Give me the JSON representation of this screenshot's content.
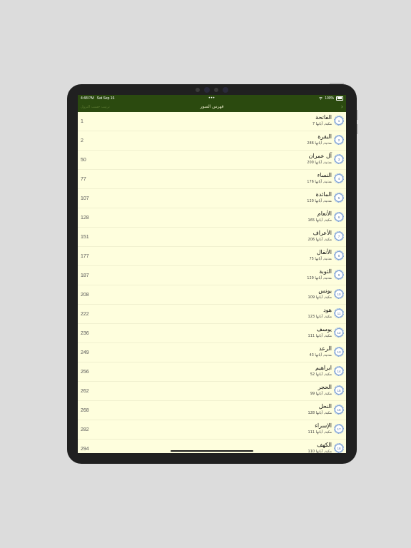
{
  "status": {
    "time": "4:48 PM",
    "date": "Sat Sep 16",
    "dots": "•••",
    "battery": "100%"
  },
  "nav": {
    "title": "فهرس السور",
    "left_label": "ترتيب حسب النزول",
    "back_icon": "chevron-right-icon"
  },
  "surahs": [
    {
      "number": "1",
      "name": "الفاتحة",
      "info": "مكية, آياتها 7",
      "page": "1"
    },
    {
      "number": "2",
      "name": "البقرة",
      "info": "مدنية, آياتها 286",
      "page": "2"
    },
    {
      "number": "3",
      "name": "آل عمران",
      "info": "مدنية, آياتها 200",
      "page": "50"
    },
    {
      "number": "4",
      "name": "النساء",
      "info": "مدنية, آياتها 176",
      "page": "77"
    },
    {
      "number": "5",
      "name": "المائدة",
      "info": "مدنية, آياتها 120",
      "page": "107"
    },
    {
      "number": "6",
      "name": "الأنعام",
      "info": "مكية, آياتها 165",
      "page": "128"
    },
    {
      "number": "7",
      "name": "الأعراف",
      "info": "مكية, آياتها 206",
      "page": "151"
    },
    {
      "number": "8",
      "name": "الأنفال",
      "info": "مدنية, آياتها 75",
      "page": "177"
    },
    {
      "number": "9",
      "name": "التوبة",
      "info": "مدنية, آياتها 129",
      "page": "187"
    },
    {
      "number": "10",
      "name": "يونس",
      "info": "مكية, آياتها 109",
      "page": "208"
    },
    {
      "number": "11",
      "name": "هود",
      "info": "مكية, آياتها 123",
      "page": "222"
    },
    {
      "number": "12",
      "name": "يوسف",
      "info": "مكية, آياتها 111",
      "page": "236"
    },
    {
      "number": "13",
      "name": "الرعد",
      "info": "مدنية, آياتها 43",
      "page": "249"
    },
    {
      "number": "14",
      "name": "ابراهيم",
      "info": "مكية, آياتها 52",
      "page": "256"
    },
    {
      "number": "15",
      "name": "الحجر",
      "info": "مكية, آياتها 99",
      "page": "262"
    },
    {
      "number": "16",
      "name": "النحل",
      "info": "مكية, آياتها 128",
      "page": "268"
    },
    {
      "number": "17",
      "name": "الإسراء",
      "info": "مكية, آياتها 111",
      "page": "282"
    },
    {
      "number": "18",
      "name": "الكهف",
      "info": "مكية, آياتها 110",
      "page": "294"
    }
  ],
  "colors": {
    "header": "#2b4a0f",
    "list_bg": "#fefedd",
    "badge": "#6d95c9"
  }
}
